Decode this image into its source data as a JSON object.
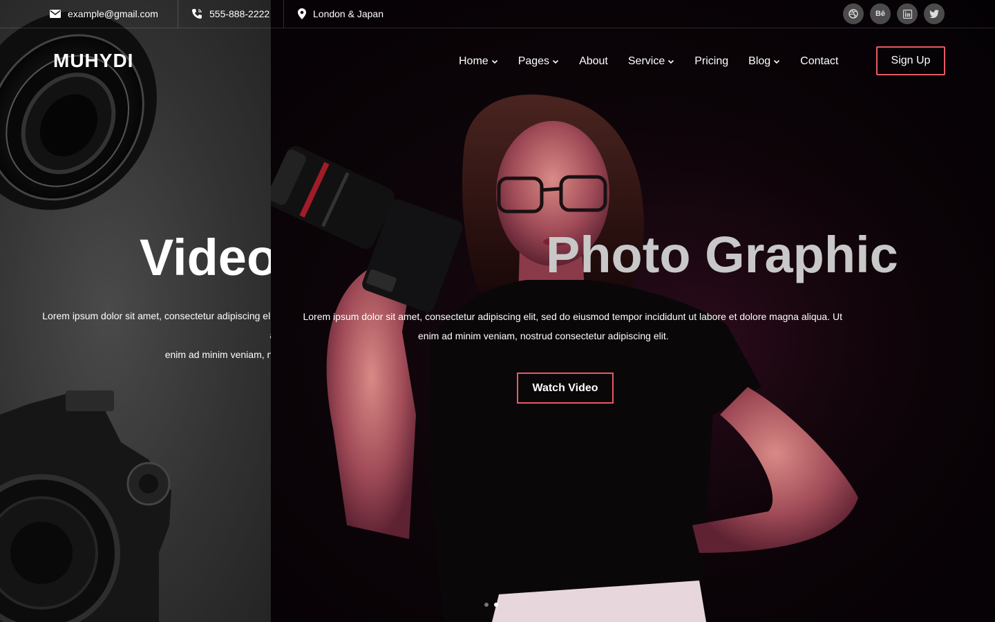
{
  "topbar": {
    "email": "example@gmail.com",
    "phone": "555-888-2222",
    "location": "London & Japan",
    "icons": {
      "email": "envelope-icon",
      "phone": "phone-icon",
      "location": "map-pin-icon"
    },
    "socials": [
      {
        "name": "dribbble-icon",
        "glyph": ""
      },
      {
        "name": "behance-icon",
        "glyph": "Bē"
      },
      {
        "name": "linkedin-icon",
        "glyph": ""
      },
      {
        "name": "twitter-icon",
        "glyph": ""
      }
    ]
  },
  "header": {
    "logo": "MUHYDI",
    "nav": [
      {
        "label": "Home",
        "dropdown": true
      },
      {
        "label": "Pages",
        "dropdown": true
      },
      {
        "label": "About",
        "dropdown": false
      },
      {
        "label": "Service",
        "dropdown": true
      },
      {
        "label": "Pricing",
        "dropdown": false
      },
      {
        "label": "Blog",
        "dropdown": true
      },
      {
        "label": "Contact",
        "dropdown": false
      }
    ],
    "signup_label": "Sign Up"
  },
  "hero": {
    "slide_prev": {
      "title": "Video",
      "description_line1": "Lorem ipsum dolor sit amet, consectetur adipiscing elit, sed do eiusmod tempor incididunt ut labore et dolore magna aliqua. Ut",
      "description_line2": "enim ad minim veniam, nostrud consectetur adipiscing elit."
    },
    "slide_current": {
      "title": "Photo Graphic",
      "description_line1": "Lorem ipsum dolor sit amet, consectetur adipiscing elit, sed do eiusmod tempor incididunt ut labore et dolore magna aliqua. Ut",
      "description_line2": "enim ad minim veniam, nostrud consectetur adipiscing elit."
    },
    "cta_label": "Watch Video",
    "slide_count": 2,
    "active_slide": 2
  },
  "colors": {
    "accent": "#e85a64",
    "topbar_border": "#2a2a2a",
    "social_bg": "#4b4b4b"
  }
}
